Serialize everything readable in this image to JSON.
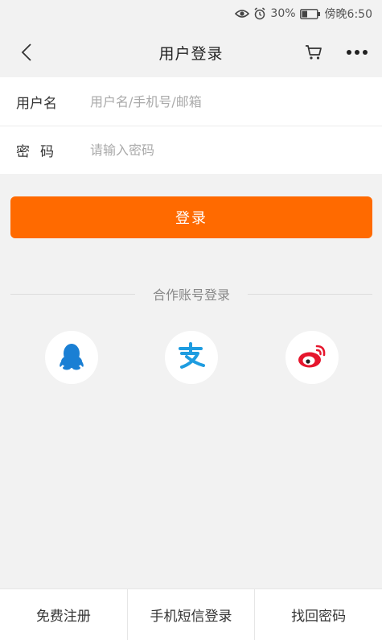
{
  "status_bar": {
    "battery_percent": "30%",
    "time": "傍晚6:50",
    "icons": [
      "eye-icon",
      "alarm-icon",
      "battery-icon"
    ]
  },
  "nav": {
    "title": "用户登录",
    "icons": [
      "back-arrow-icon",
      "cart-icon",
      "more-icon"
    ]
  },
  "form": {
    "username_label": "用户名",
    "username_placeholder": "用户名/手机号/邮箱",
    "username_value": "",
    "password_label": "密码",
    "password_placeholder": "请输入密码",
    "password_value": ""
  },
  "login_button": "登录",
  "partner_login": {
    "title": "合作账号登录",
    "providers": [
      "qq-icon",
      "alipay-icon",
      "weibo-icon"
    ]
  },
  "bottom_bar": {
    "register": "免费注册",
    "sms_login": "手机短信登录",
    "recover_password": "找回密码"
  },
  "colors": {
    "accent": "#ff6a00",
    "qq_blue": "#1a7fd4",
    "alipay_blue": "#1e9ce0",
    "weibo_red": "#e6162d"
  }
}
